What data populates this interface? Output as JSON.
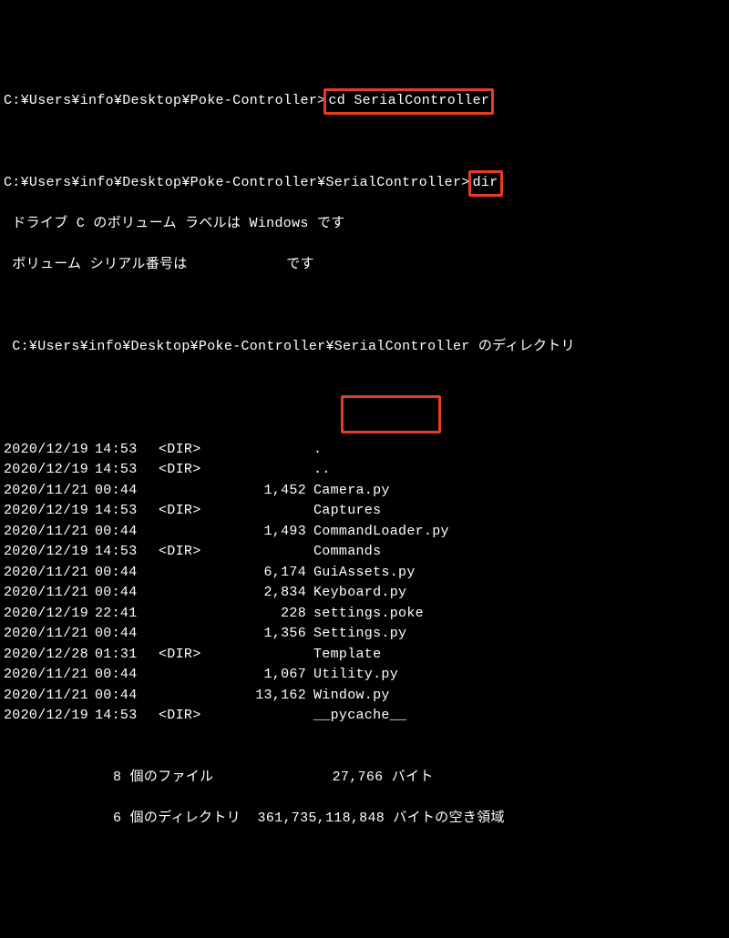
{
  "prompt1_path": "C:¥Users¥info¥Desktop¥Poke-Controller",
  "cmd1": "cd SerialController",
  "prompt2_path": "C:¥Users¥info¥Desktop¥Poke-Controller¥SerialController",
  "cmd2": "dir",
  "vol_line": " ドライブ C のボリューム ラベルは Windows です",
  "serial_prefix": " ボリューム シリアル番号は ",
  "serial_suffix": " です",
  "dir_of": " C:¥Users¥info¥Desktop¥Poke-Controller¥SerialController のディレクトリ",
  "rows": [
    {
      "date": "2020/12/19",
      "time": "14:53",
      "attr": "<DIR>",
      "size": "",
      "name": "."
    },
    {
      "date": "2020/12/19",
      "time": "14:53",
      "attr": "<DIR>",
      "size": "",
      "name": ".."
    },
    {
      "date": "2020/11/21",
      "time": "00:44",
      "attr": "",
      "size": "1,452",
      "name": "Camera.py"
    },
    {
      "date": "2020/12/19",
      "time": "14:53",
      "attr": "<DIR>",
      "size": "",
      "name": "Captures"
    },
    {
      "date": "2020/11/21",
      "time": "00:44",
      "attr": "",
      "size": "1,493",
      "name": "CommandLoader.py"
    },
    {
      "date": "2020/12/19",
      "time": "14:53",
      "attr": "<DIR>",
      "size": "",
      "name": "Commands"
    },
    {
      "date": "2020/11/21",
      "time": "00:44",
      "attr": "",
      "size": "6,174",
      "name": "GuiAssets.py"
    },
    {
      "date": "2020/11/21",
      "time": "00:44",
      "attr": "",
      "size": "2,834",
      "name": "Keyboard.py"
    },
    {
      "date": "2020/12/19",
      "time": "22:41",
      "attr": "",
      "size": "228",
      "name": "settings.poke"
    },
    {
      "date": "2020/11/21",
      "time": "00:44",
      "attr": "",
      "size": "1,356",
      "name": "Settings.py"
    },
    {
      "date": "2020/12/28",
      "time": "01:31",
      "attr": "<DIR>",
      "size": "",
      "name": "Template"
    },
    {
      "date": "2020/11/21",
      "time": "00:44",
      "attr": "",
      "size": "1,067",
      "name": "Utility.py"
    },
    {
      "date": "2020/11/21",
      "time": "00:44",
      "attr": "",
      "size": "13,162",
      "name": "Window.py"
    },
    {
      "date": "2020/12/19",
      "time": "14:53",
      "attr": "<DIR>",
      "size": "",
      "name": "__pycache__"
    }
  ],
  "summary_files": "8 個のファイル              27,766 バイト",
  "summary_dirs": "6 個のディレクトリ  361,735,118,848 バイトの空き領域",
  "highlight_file": "Window.py"
}
